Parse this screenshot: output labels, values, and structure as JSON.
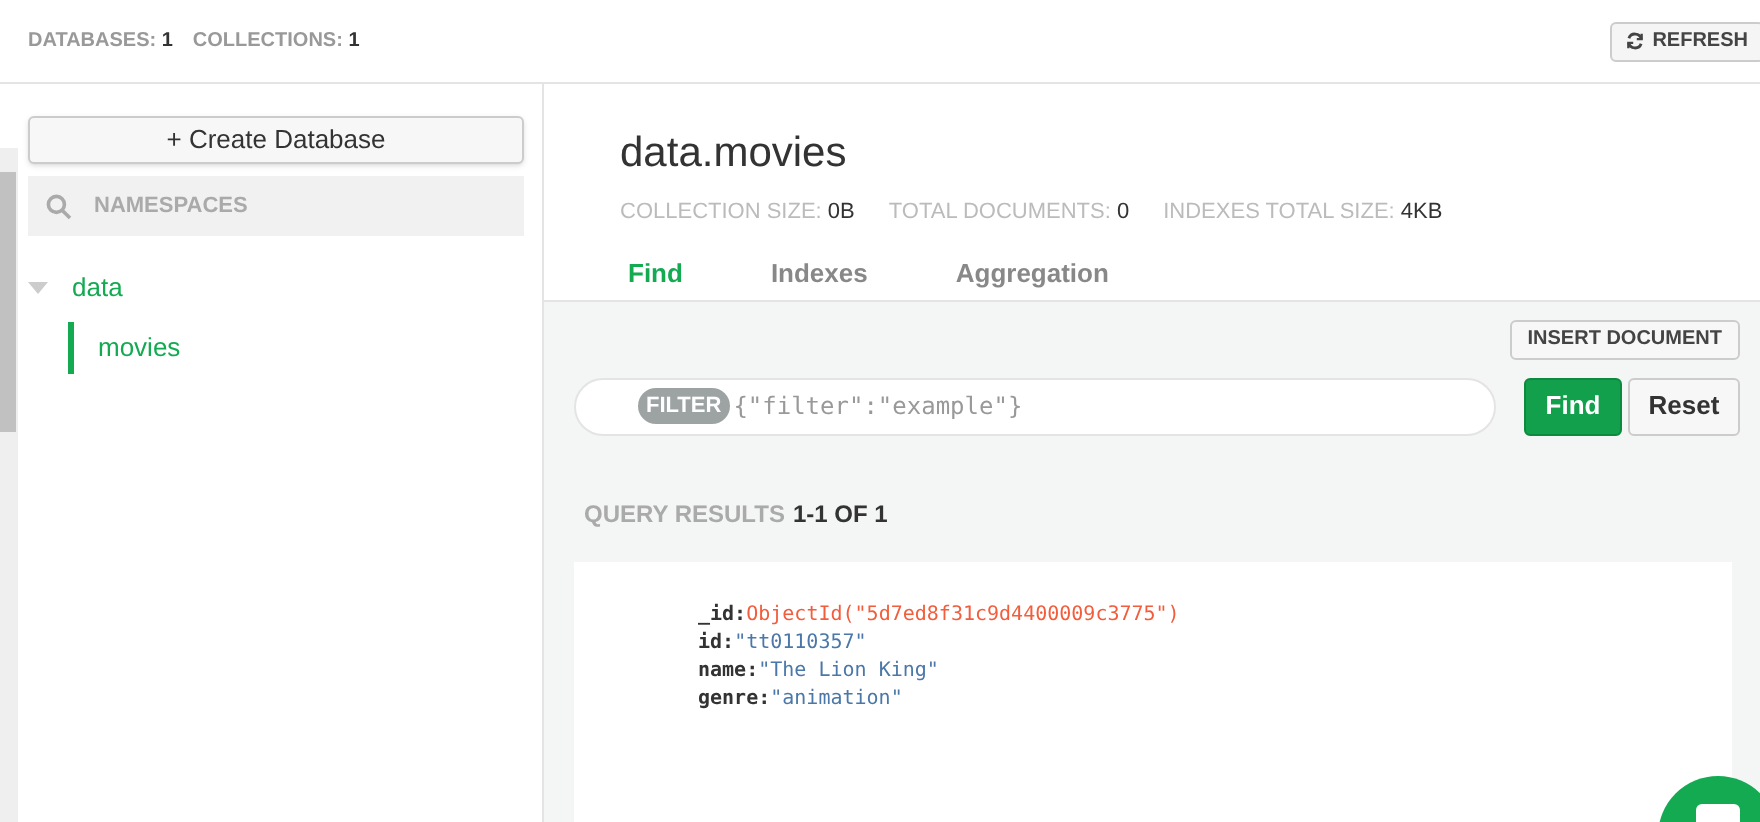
{
  "header": {
    "stats": [
      {
        "label": "DATABASES:",
        "value": "1"
      },
      {
        "label": "COLLECTIONS:",
        "value": "1"
      }
    ],
    "refresh_button": "REFRESH"
  },
  "sidebar": {
    "create_button": "+ Create Database",
    "search": {
      "placeholder": "NAMESPACES"
    },
    "tree": [
      {
        "label": "data",
        "expanded": true,
        "children": [
          {
            "label": "movies",
            "selected": true
          }
        ]
      }
    ]
  },
  "collection": {
    "title": "data.movies",
    "stats": [
      {
        "label": "COLLECTION SIZE:",
        "value": "0B"
      },
      {
        "label": "TOTAL DOCUMENTS:",
        "value": "0"
      },
      {
        "label": "INDEXES TOTAL SIZE:",
        "value": "4KB"
      }
    ],
    "tabs": [
      {
        "label": "Find",
        "selected": true
      },
      {
        "label": "Indexes",
        "selected": false
      },
      {
        "label": "Aggregation",
        "selected": false
      }
    ]
  },
  "query": {
    "insert_button": "INSERT DOCUMENT",
    "filter_badge": "FILTER",
    "filter": {
      "placeholder": "{\"filter\":\"example\"}"
    },
    "find_button": "Find",
    "reset_button": "Reset",
    "results_label": "QUERY RESULTS",
    "results_count": "1-1 OF 1",
    "document": [
      {
        "key": "_id:",
        "kind": "objectid",
        "value": "ObjectId(\"5d7ed8f31c9d4400009c3775\")"
      },
      {
        "key": "id:",
        "kind": "string",
        "value": "\"tt0110357\""
      },
      {
        "key": "name:",
        "kind": "string",
        "value": "\"The Lion King\""
      },
      {
        "key": "genre:",
        "kind": "string",
        "value": "\"animation\""
      }
    ]
  }
}
